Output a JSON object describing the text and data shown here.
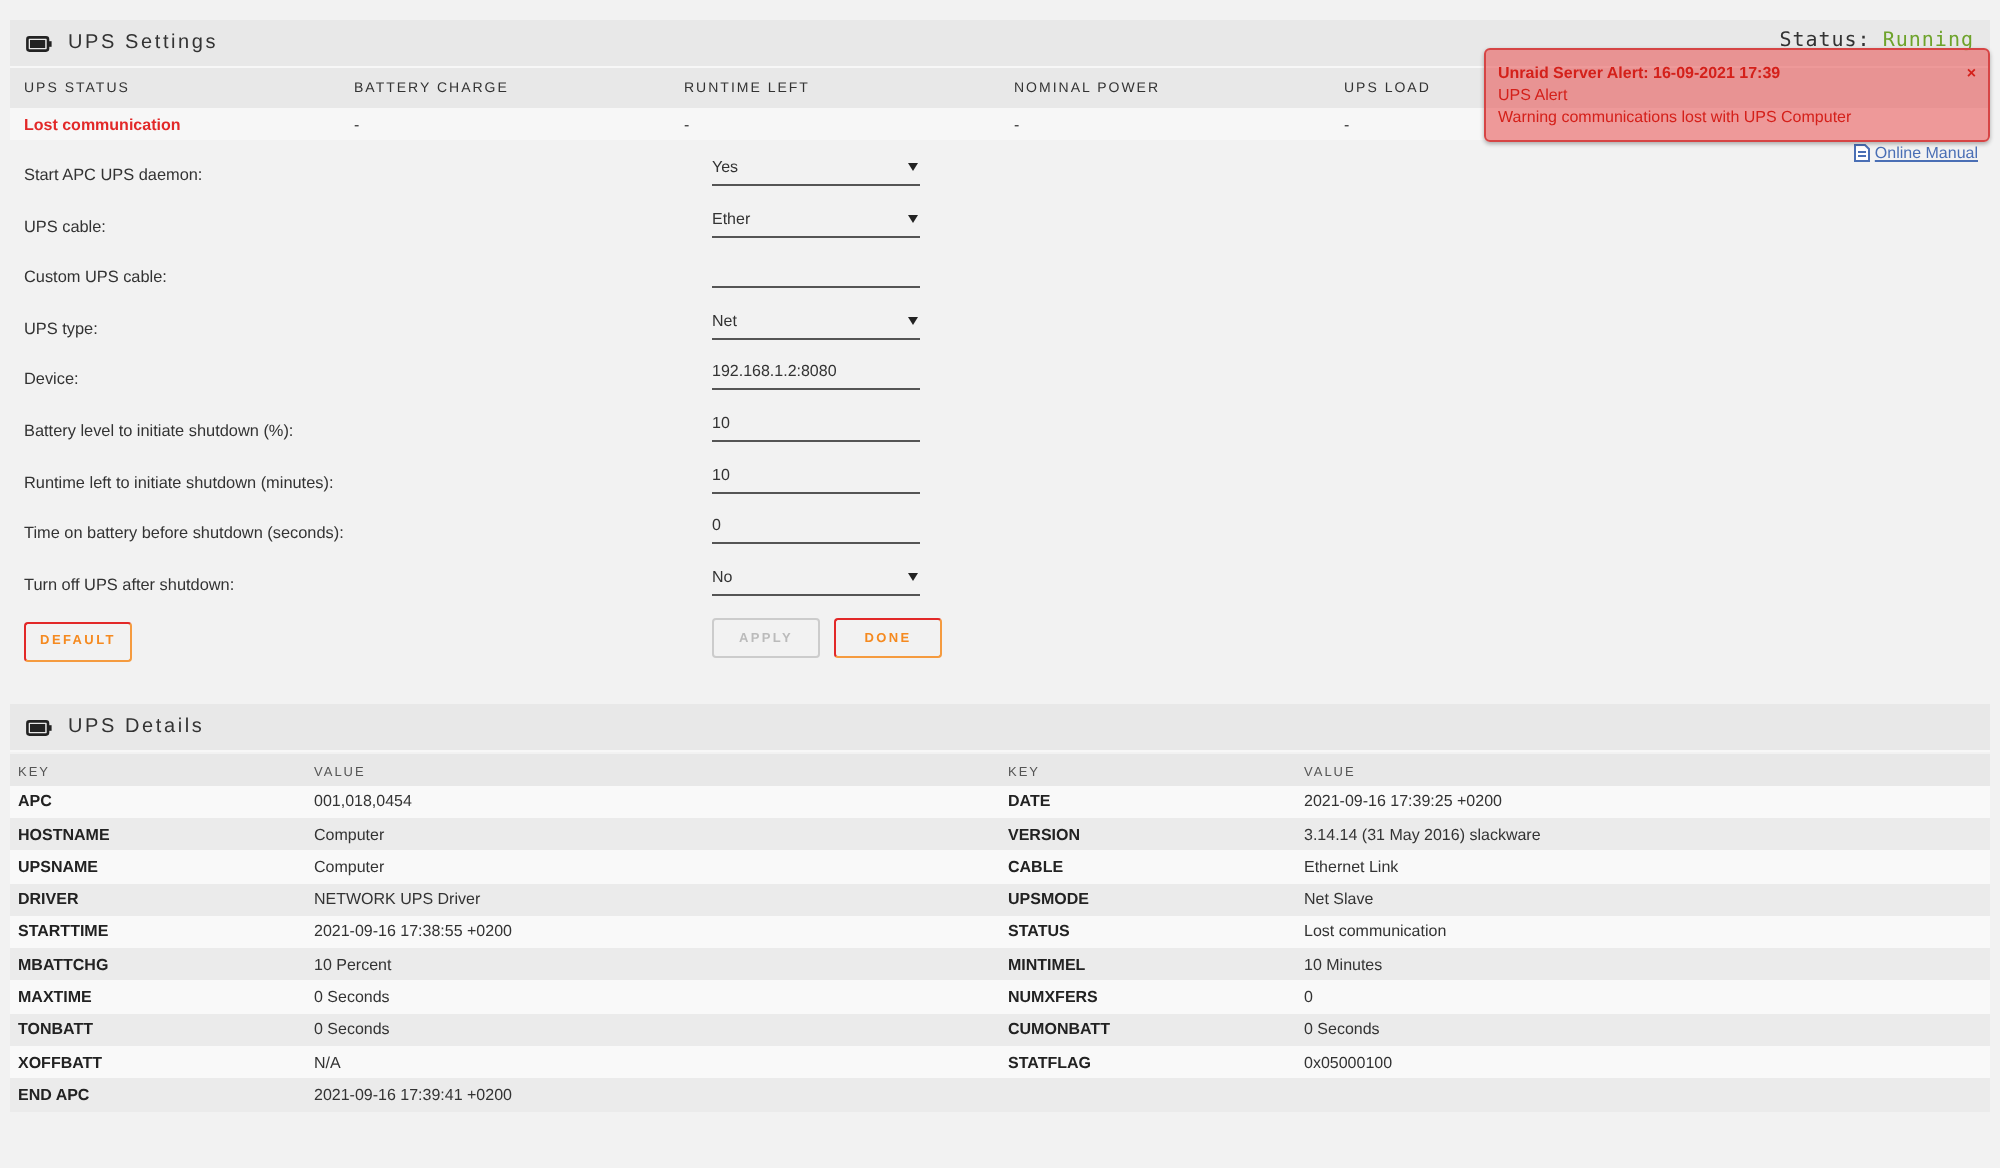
{
  "settings": {
    "title": "UPS Settings",
    "status_label": "Status:",
    "status_value": "Running",
    "status_columns": [
      "UPS STATUS",
      "BATTERY CHARGE",
      "RUNTIME LEFT",
      "NOMINAL POWER",
      "UPS LOAD"
    ],
    "status_row": [
      {
        "text": "Lost communication",
        "alert": true
      },
      {
        "text": "-",
        "alert": false
      },
      {
        "text": "-",
        "alert": false
      },
      {
        "text": "-",
        "alert": false
      },
      {
        "text": "-",
        "alert": false
      }
    ],
    "manual_link": "Online Manual",
    "fields": [
      {
        "label": "Start APC UPS daemon:",
        "kind": "select",
        "value": "Yes"
      },
      {
        "label": "UPS cable:",
        "kind": "select",
        "value": "Ether"
      },
      {
        "label": "Custom UPS cable:",
        "kind": "text"
      },
      {
        "label": "UPS type:",
        "kind": "select",
        "value": "Net"
      },
      {
        "label": "Device:",
        "kind": "text",
        "value": "192.168.1.2:8080"
      },
      {
        "label": "Battery level to initiate shutdown (%):",
        "kind": "text",
        "value": "10"
      },
      {
        "label": "Runtime left to initiate shutdown (minutes):",
        "kind": "text",
        "value": "10"
      },
      {
        "label": "Time on battery before shutdown (seconds):",
        "kind": "text",
        "value": "0"
      },
      {
        "label": "Turn off UPS after shutdown:",
        "kind": "select",
        "value": "No"
      }
    ],
    "left_buttons": [
      {
        "label": "DEFAULT",
        "disabled": false
      }
    ],
    "right_buttons": [
      {
        "label": "APPLY",
        "disabled": true
      },
      {
        "label": "DONE",
        "disabled": false
      }
    ]
  },
  "details": {
    "title": "UPS Details",
    "left": {
      "columns": [
        "KEY",
        "VALUE"
      ],
      "rows": [
        {
          "key": "APC",
          "value": "001,018,0454"
        },
        {
          "key": "HOSTNAME",
          "value": "Computer"
        },
        {
          "key": "UPSNAME",
          "value": "Computer"
        },
        {
          "key": "DRIVER",
          "value": "NETWORK UPS Driver"
        },
        {
          "key": "STARTTIME",
          "value": "2021-09-16 17:38:55 +0200"
        },
        {
          "key": "MBATTCHG",
          "value": "10 Percent"
        },
        {
          "key": "MAXTIME",
          "value": "0 Seconds"
        },
        {
          "key": "TONBATT",
          "value": "0 Seconds"
        },
        {
          "key": "XOFFBATT",
          "value": "N/A"
        },
        {
          "key": "END APC",
          "value": "2021-09-16 17:39:41 +0200"
        }
      ]
    },
    "right": {
      "columns": [
        "KEY",
        "VALUE"
      ],
      "rows": [
        {
          "key": "DATE",
          "value": "2021-09-16 17:39:25 +0200"
        },
        {
          "key": "VERSION",
          "value": "3.14.14 (31 May 2016) slackware"
        },
        {
          "key": "CABLE",
          "value": "Ethernet Link"
        },
        {
          "key": "UPSMODE",
          "value": "Net Slave"
        },
        {
          "key": "STATUS",
          "value": "Lost communication"
        },
        {
          "key": "MINTIMEL",
          "value": "10 Minutes"
        },
        {
          "key": "NUMXFERS",
          "value": "0"
        },
        {
          "key": "CUMONBATT",
          "value": "0 Seconds"
        },
        {
          "key": "STATFLAG",
          "value": "0x05000100"
        }
      ]
    }
  },
  "alert": {
    "title": "Unraid Server Alert: 16-09-2021 17:39",
    "close": "×",
    "subject": "UPS Alert",
    "message": "Warning communications lost with UPS Computer"
  }
}
